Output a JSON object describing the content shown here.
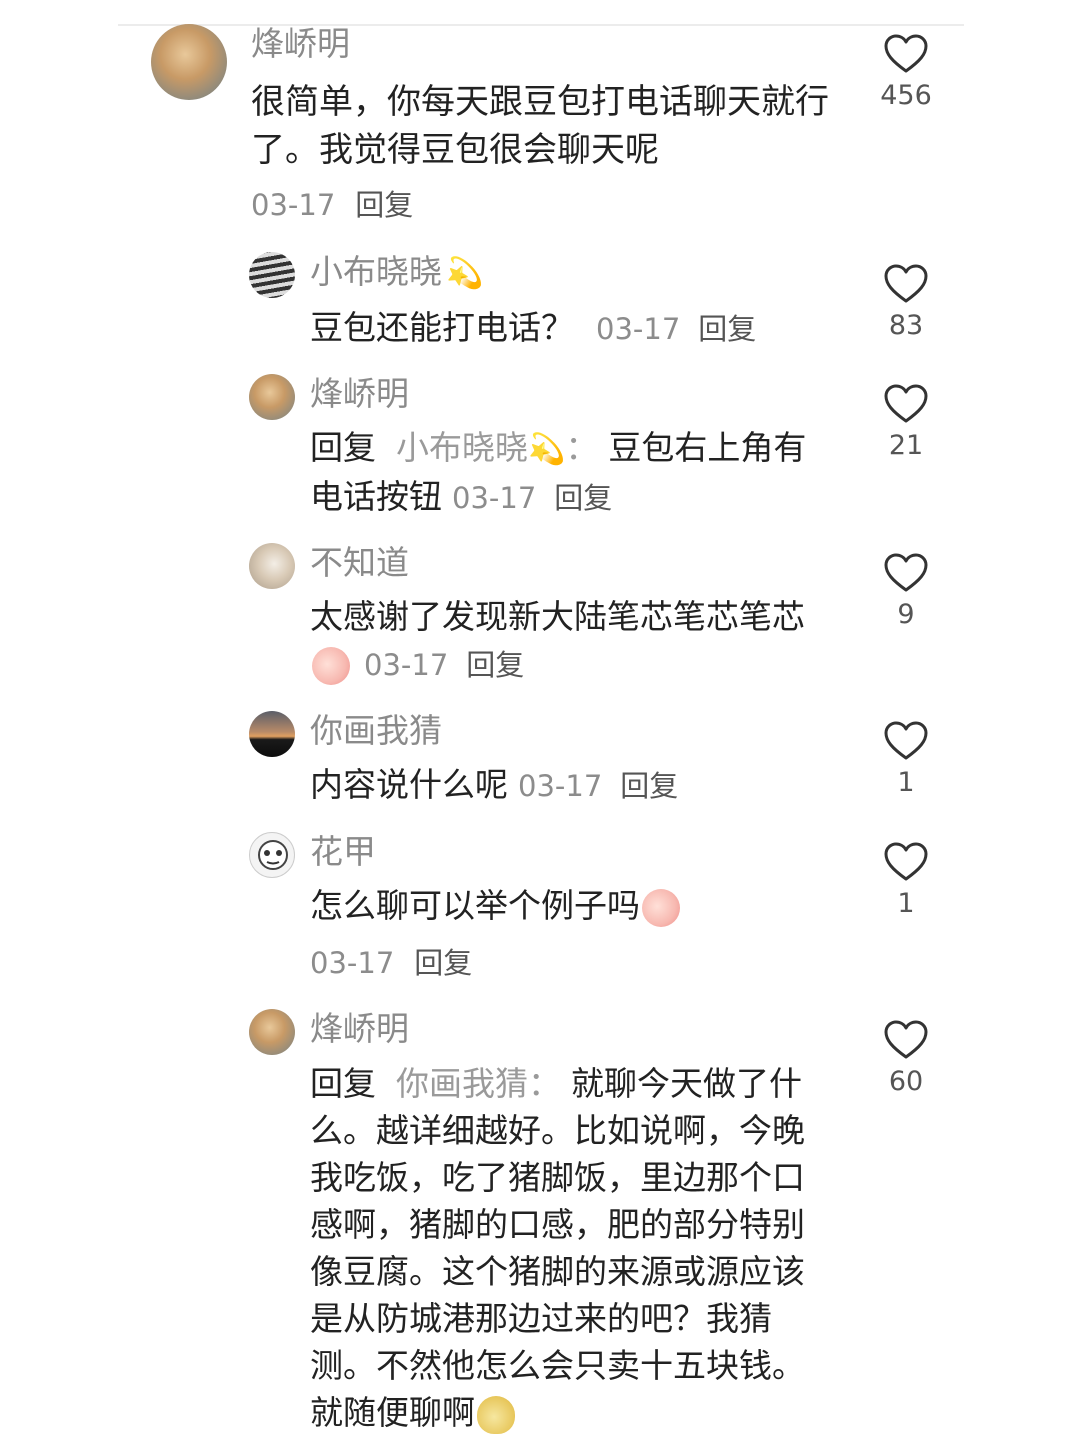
{
  "comments": [
    {
      "user": "烽峤明",
      "text": "很简单，你每天跟豆包打电话聊天就行了。我觉得豆包很会聊天呢",
      "date": "03-17",
      "reply_label": "回复",
      "likes": "456"
    },
    {
      "user": "小布晓晓",
      "text": "豆包还能打电话？",
      "date": "03-17",
      "reply_label": "回复",
      "likes": "83"
    },
    {
      "user": "烽峤明",
      "reply_prefix": "回复",
      "mention": "小布晓晓",
      "text": "豆包右上角有电话按钮",
      "date": "03-17",
      "reply_label": "回复",
      "likes": "21"
    },
    {
      "user": "不知道",
      "text": "太感谢了发现新大陆笔芯笔芯笔芯",
      "date": "03-17",
      "reply_label": "回复",
      "likes": "9"
    },
    {
      "user": "你画我猜",
      "text": "内容说什么呢",
      "date": "03-17",
      "reply_label": "回复",
      "likes": "1"
    },
    {
      "user": "花甲",
      "text": "怎么聊可以举个例子吗",
      "date": "03-17",
      "reply_label": "回复",
      "likes": "1"
    },
    {
      "user": "烽峤明",
      "reply_prefix": "回复",
      "mention": "你画我猜",
      "text": "就聊今天做了什么。越详细越好。比如说啊，今晚我吃饭，吃了猪脚饭，里边那个口感啊，猪脚的口感，肥的部分特别像豆腐。这个猪脚的来源或源应该是从防城港那边过来的吧？我猜测。不然他怎么会只卖十五块钱。就随便聊啊",
      "likes": "60"
    }
  ],
  "colors": {
    "username": "#8a8a8a",
    "text": "#222222",
    "meta": "#8c8c8c"
  },
  "icons": {
    "like": "heart-outline-icon"
  }
}
